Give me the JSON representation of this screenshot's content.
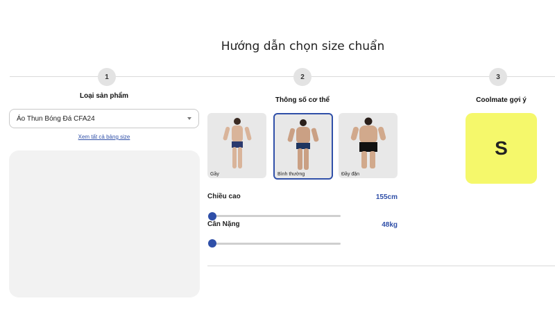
{
  "page": {
    "title": "Hướng dẫn chọn size chuẩn"
  },
  "steps": [
    {
      "number": "1",
      "title": "Loại sản phẩm"
    },
    {
      "number": "2",
      "title": "Thông số cơ thể"
    },
    {
      "number": "3",
      "title": "Coolmate gợi ý"
    }
  ],
  "product": {
    "selected": "Áo Thun Bóng Đá CFA24",
    "size_table_link": "Xem tất cả bảng size"
  },
  "body_types": [
    {
      "label": "Gầy",
      "selected": false
    },
    {
      "label": "Bình thường",
      "selected": true
    },
    {
      "label": "Đầy đặn",
      "selected": false
    }
  ],
  "height": {
    "label": "Chiều cao",
    "value": "155cm",
    "fraction": 0.0
  },
  "weight": {
    "label": "Cân Nặng",
    "value": "48kg",
    "fraction": 0.0
  },
  "result": {
    "size": "S"
  },
  "colors": {
    "accent": "#2f4fa8",
    "result_bg": "#f5f86b",
    "card_bg": "#e8e8e8"
  }
}
